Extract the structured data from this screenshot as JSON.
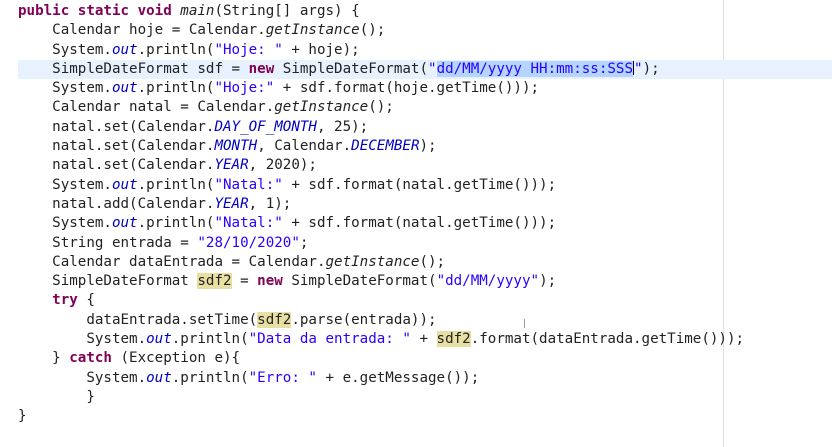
{
  "editor": {
    "lines": [
      [
        {
          "t": "public static void ",
          "c": "kw"
        },
        {
          "t": "main",
          "c": "m"
        },
        {
          "t": "(String[] args) {"
        }
      ],
      [
        {
          "t": "    Calendar hoje = Calendar."
        },
        {
          "t": "getInstance",
          "c": "m"
        },
        {
          "t": "();"
        }
      ],
      [
        {
          "t": "    System."
        },
        {
          "t": "out",
          "c": "f"
        },
        {
          "t": ".println("
        },
        {
          "t": "\"Hoje: \"",
          "c": "s"
        },
        {
          "t": " + hoje);"
        }
      ],
      [
        {
          "t": "    SimpleDateFormat sdf = "
        },
        {
          "t": "new ",
          "c": "kw"
        },
        {
          "t": "SimpleDateFormat("
        },
        {
          "t": "\"",
          "c": "s"
        },
        {
          "t": "dd/MM/yyyy HH:mm:ss:SSS",
          "c": "s sel"
        },
        {
          "t": "",
          "c": "caret"
        },
        {
          "t": "\"",
          "c": "s"
        },
        {
          "t": ");"
        }
      ],
      [
        {
          "t": "    System."
        },
        {
          "t": "out",
          "c": "f"
        },
        {
          "t": ".println("
        },
        {
          "t": "\"Hoje:\"",
          "c": "s"
        },
        {
          "t": " + sdf.format(hoje.getTime()));"
        }
      ],
      [
        {
          "t": "    Calendar natal = Calendar."
        },
        {
          "t": "getInstance",
          "c": "m"
        },
        {
          "t": "();"
        }
      ],
      [
        {
          "t": "    natal.set(Calendar."
        },
        {
          "t": "DAY_OF_MONTH",
          "c": "f"
        },
        {
          "t": ", 25);"
        }
      ],
      [
        {
          "t": "    natal.set(Calendar."
        },
        {
          "t": "MONTH",
          "c": "f"
        },
        {
          "t": ", Calendar."
        },
        {
          "t": "DECEMBER",
          "c": "f"
        },
        {
          "t": ");"
        }
      ],
      [
        {
          "t": "    natal.set(Calendar."
        },
        {
          "t": "YEAR",
          "c": "f"
        },
        {
          "t": ", 2020);"
        }
      ],
      [
        {
          "t": "    System."
        },
        {
          "t": "out",
          "c": "f"
        },
        {
          "t": ".println("
        },
        {
          "t": "\"Natal:\"",
          "c": "s"
        },
        {
          "t": " + sdf.format(natal.getTime()));"
        }
      ],
      [
        {
          "t": "    natal.add(Calendar."
        },
        {
          "t": "YEAR",
          "c": "f"
        },
        {
          "t": ", 1);"
        }
      ],
      [
        {
          "t": "    System."
        },
        {
          "t": "out",
          "c": "f"
        },
        {
          "t": ".println("
        },
        {
          "t": "\"Natal:\"",
          "c": "s"
        },
        {
          "t": " + sdf.format(natal.getTime()));"
        }
      ],
      [
        {
          "t": "    String entrada = "
        },
        {
          "t": "\"28/10/2020\"",
          "c": "s"
        },
        {
          "t": ";"
        }
      ],
      [
        {
          "t": "    Calendar dataEntrada = Calendar."
        },
        {
          "t": "getInstance",
          "c": "m"
        },
        {
          "t": "();"
        }
      ],
      [
        {
          "t": "    SimpleDateFormat "
        },
        {
          "t": "sdf2",
          "c": "occ"
        },
        {
          "t": " = "
        },
        {
          "t": "new ",
          "c": "kw"
        },
        {
          "t": "SimpleDateFormat("
        },
        {
          "t": "\"dd/MM/yyyy\"",
          "c": "s"
        },
        {
          "t": ");"
        }
      ],
      [
        {
          "t": "    "
        },
        {
          "t": "try",
          "c": "kw"
        },
        {
          "t": " {"
        }
      ],
      [
        {
          "t": "        dataEntrada.setTime("
        },
        {
          "t": "sdf2",
          "c": "occ"
        },
        {
          "t": ".parse(entrada));"
        }
      ],
      [
        {
          "t": "        System."
        },
        {
          "t": "out",
          "c": "f"
        },
        {
          "t": ".println("
        },
        {
          "t": "\"Data da entrada: \"",
          "c": "s"
        },
        {
          "t": " + "
        },
        {
          "t": "sdf2",
          "c": "occ"
        },
        {
          "t": ".format(dataEntrada.getTime()));"
        }
      ],
      [
        {
          "t": "    } "
        },
        {
          "t": "catch",
          "c": "kw"
        },
        {
          "t": " (Exception e){"
        }
      ],
      [
        {
          "t": "        System."
        },
        {
          "t": "out",
          "c": "f"
        },
        {
          "t": ".println("
        },
        {
          "t": "\"Erro: \"",
          "c": "s"
        },
        {
          "t": " + e.getMessage());"
        }
      ],
      [
        {
          "t": "        }"
        }
      ],
      [
        {
          "t": "}"
        }
      ]
    ],
    "current_line": 3
  }
}
